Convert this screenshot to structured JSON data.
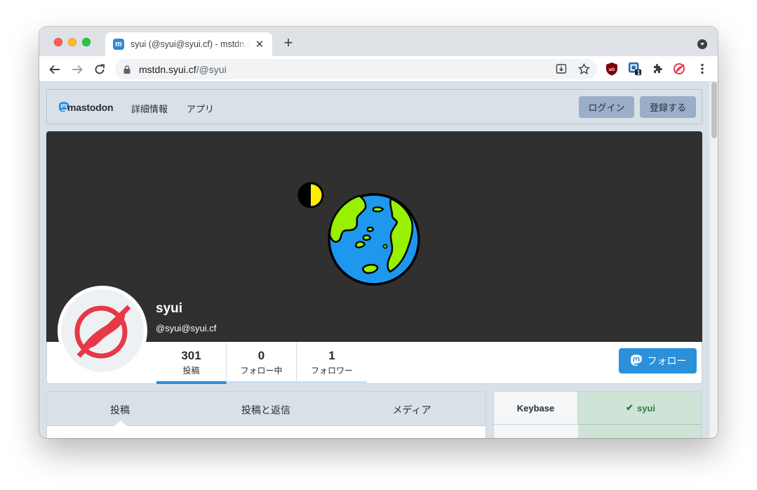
{
  "browser": {
    "tab_title": "syui (@syui@syui.cf) - mstdn.syui.cf",
    "tab_close": "✕",
    "new_tab": "+",
    "url_host": "mstdn.syui.cf",
    "url_path": "/@syui",
    "ext_badge": "1"
  },
  "header": {
    "logo_text": "mastodon",
    "nav": [
      "詳細情報",
      "アプリ"
    ],
    "login_label": "ログイン",
    "register_label": "登録する"
  },
  "profile": {
    "display_name": "syui",
    "account": "@syui@syui.cf",
    "counters": [
      {
        "num": "301",
        "label": "投稿"
      },
      {
        "num": "0",
        "label": "フォロー中"
      },
      {
        "num": "1",
        "label": "フォロワー"
      }
    ],
    "follow_label": "フォロー"
  },
  "tabs": [
    "投稿",
    "投稿と返信",
    "メディア"
  ],
  "keybase": {
    "label": "Keybase",
    "value": "syui",
    "check": "✔"
  },
  "colors": {
    "accent": "#2b90d9",
    "banner": "#303030",
    "earth_ocean": "#1e97ee",
    "earth_land": "#97f100",
    "moon": "#ffee00",
    "avatar_bird": "#e63946"
  }
}
